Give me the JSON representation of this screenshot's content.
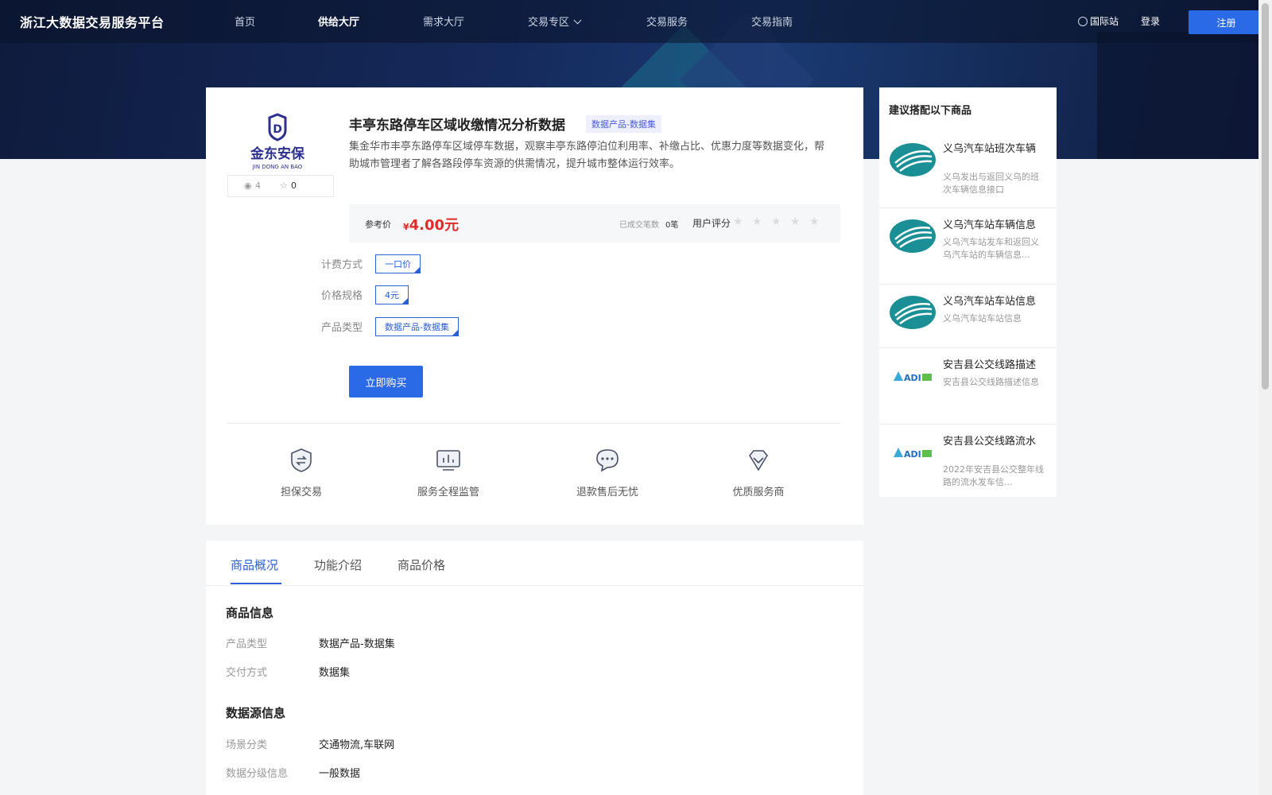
{
  "nav": {
    "brand": "浙江大数据交易服务平台",
    "items": [
      {
        "label": "首页"
      },
      {
        "label": "供给大厅"
      },
      {
        "label": "需求大厅"
      },
      {
        "label": "交易专区"
      },
      {
        "label": "交易服务"
      },
      {
        "label": "交易指南"
      }
    ],
    "intl": "国际站",
    "login": "登录",
    "register": "注册"
  },
  "product": {
    "logo_text_cn": "金东安保",
    "logo_text_en": "JIN DONG AN BAO",
    "views": "4",
    "favorites": "0",
    "title": "丰亭东路停车区域收缴情况分析数据",
    "tag": "数据产品-数据集",
    "description": "集金华市丰亭东路停车区域停车数据，观察丰亭东路停泊位利用率、补缴占比、优惠力度等数据变化，帮助城市管理者了解各路段停车资源的供需情况，提升城市整体运行效率。",
    "price_label": "参考价",
    "currency": "¥",
    "price": "4.00元",
    "deals_label": "已成交笔数",
    "deals": "0笔",
    "rating_label": "用户评分",
    "rating": 0,
    "rating_max": 5,
    "options": [
      {
        "label": "计费方式",
        "value": "一口价"
      },
      {
        "label": "价格规格",
        "value": "4元"
      },
      {
        "label": "产品类型",
        "value": "数据产品-数据集"
      }
    ],
    "buy_label": "立即购买",
    "features": [
      {
        "label": "担保交易",
        "icon": "shield-exchange-icon"
      },
      {
        "label": "服务全程监管",
        "icon": "monitor-chart-icon"
      },
      {
        "label": "退款售后无忧",
        "icon": "chat-bubble-icon"
      },
      {
        "label": "优质服务商",
        "icon": "diamond-icon"
      }
    ]
  },
  "recommend": {
    "title": "建议搭配以下商品",
    "items": [
      {
        "name": "义乌汽车站班次车辆",
        "desc": "义乌发出与返回义乌的班次车辆信息接口",
        "logo": "bus-station-logo"
      },
      {
        "name": "义乌汽车站车辆信息",
        "desc": "义乌汽车站发车和返回义乌汽车站的车辆信息...",
        "logo": "bus-station-logo"
      },
      {
        "name": "义乌汽车站车站信息",
        "desc": "义乌汽车站车站信息",
        "logo": "bus-station-logo"
      },
      {
        "name": "安吉县公交线路描述",
        "desc": "安吉县公交线路描述信息",
        "logo": "adi-logo"
      },
      {
        "name": "安吉县公交线路流水",
        "desc": "2022年安吉县公交整年线路的流水发车信...",
        "logo": "adi-logo"
      }
    ]
  },
  "tabs": [
    {
      "label": "商品概况"
    },
    {
      "label": "功能介绍"
    },
    {
      "label": "商品价格"
    }
  ],
  "info": {
    "section1_title": "商品信息",
    "section1": [
      {
        "key": "产品类型",
        "value": "数据产品-数据集"
      },
      {
        "key": "交付方式",
        "value": "数据集"
      }
    ],
    "section2_title": "数据源信息",
    "section2": [
      {
        "key": "场景分类",
        "value": "交通物流,车联网"
      },
      {
        "key": "数据分级信息",
        "value": "一般数据"
      }
    ]
  },
  "colors": {
    "accent": "#2b6ae6",
    "price": "#e32b2b",
    "nav_bg": "#0f1b3d"
  }
}
